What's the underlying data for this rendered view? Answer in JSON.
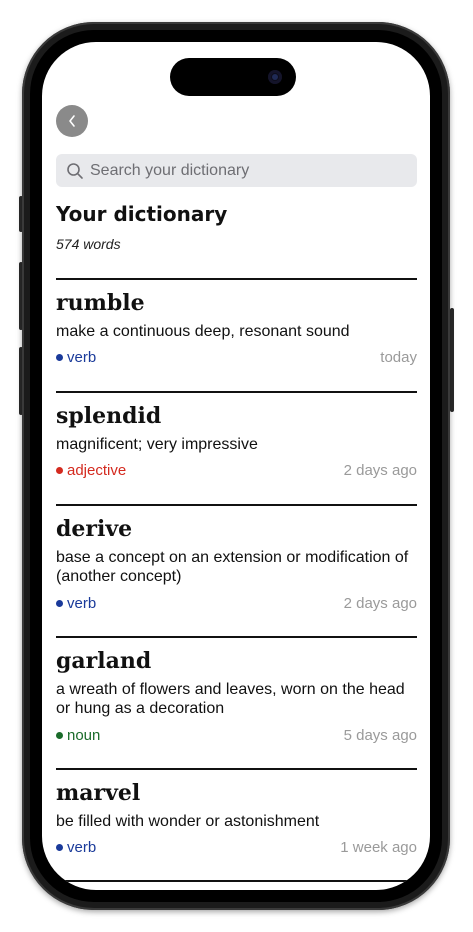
{
  "search": {
    "placeholder": "Search your dictionary"
  },
  "header": {
    "title": "Your dictionary",
    "count": "574 words"
  },
  "pos_colors": {
    "verb": "#1a3a9a",
    "adjective": "#d42a1f",
    "noun": "#1a6b2a"
  },
  "entries": [
    {
      "word": "rumble",
      "definition": "make a continuous deep, resonant sound",
      "pos": "verb",
      "date": "today"
    },
    {
      "word": "splendid",
      "definition": "magnificent; very impressive",
      "pos": "adjective",
      "date": "2 days ago"
    },
    {
      "word": "derive",
      "definition": "base a concept on an extension or modification of (another concept)",
      "pos": "verb",
      "date": "2 days ago"
    },
    {
      "word": "garland",
      "definition": "a wreath of flowers and leaves, worn on the head or hung as a decoration",
      "pos": "noun",
      "date": "5 days ago"
    },
    {
      "word": "marvel",
      "definition": "be filled with wonder or astonishment",
      "pos": "verb",
      "date": "1 week ago"
    }
  ]
}
